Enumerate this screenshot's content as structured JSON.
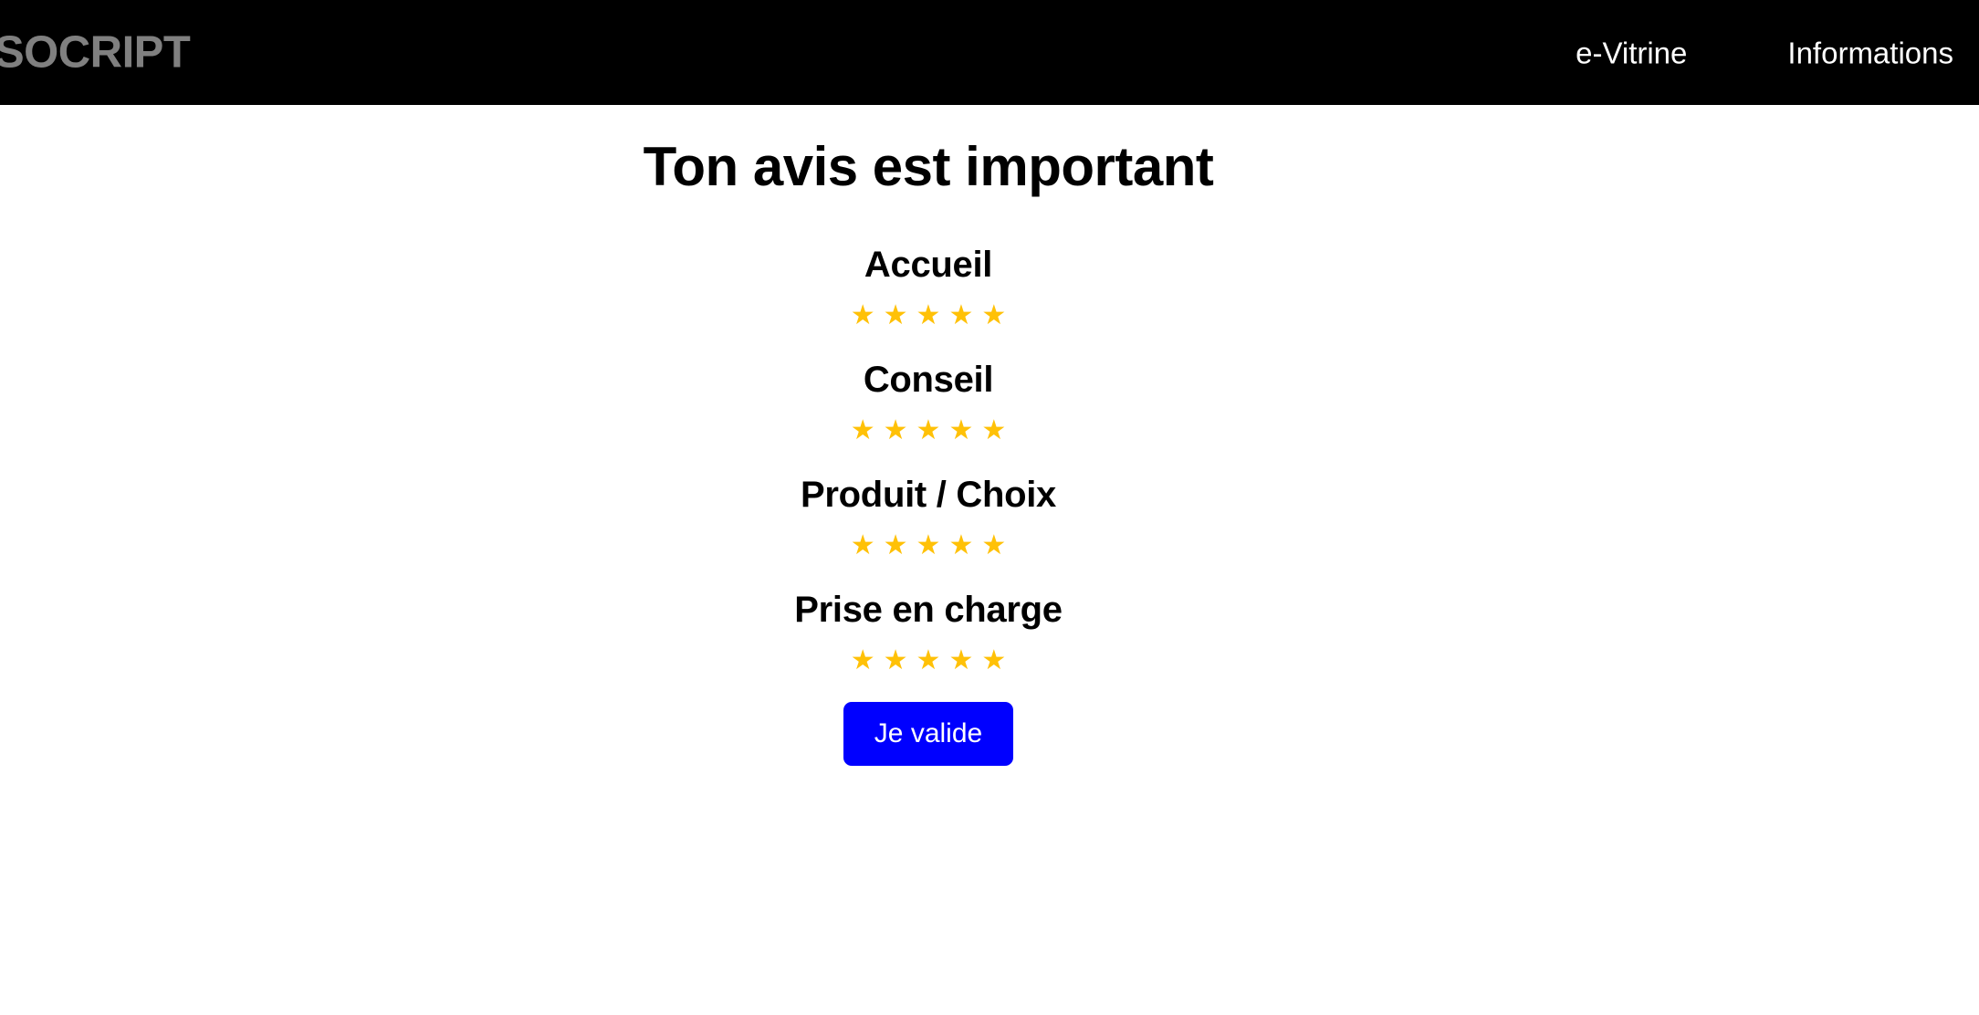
{
  "header": {
    "brand": "SOCRIPT",
    "nav": [
      {
        "label": "e-Vitrine"
      },
      {
        "label": "Informations"
      }
    ]
  },
  "main": {
    "title": "Ton avis est important",
    "star_glyph": "★",
    "max_stars": 5,
    "accent_color": "#FFC107",
    "ratings": [
      {
        "label": "Accueil",
        "value": 5
      },
      {
        "label": "Conseil",
        "value": 5
      },
      {
        "label": "Produit / Choix",
        "value": 5
      },
      {
        "label": "Prise en charge",
        "value": 5
      }
    ],
    "submit": {
      "label": "Je valide",
      "color": "#0000FF",
      "text_color": "#FFFFFF"
    }
  }
}
